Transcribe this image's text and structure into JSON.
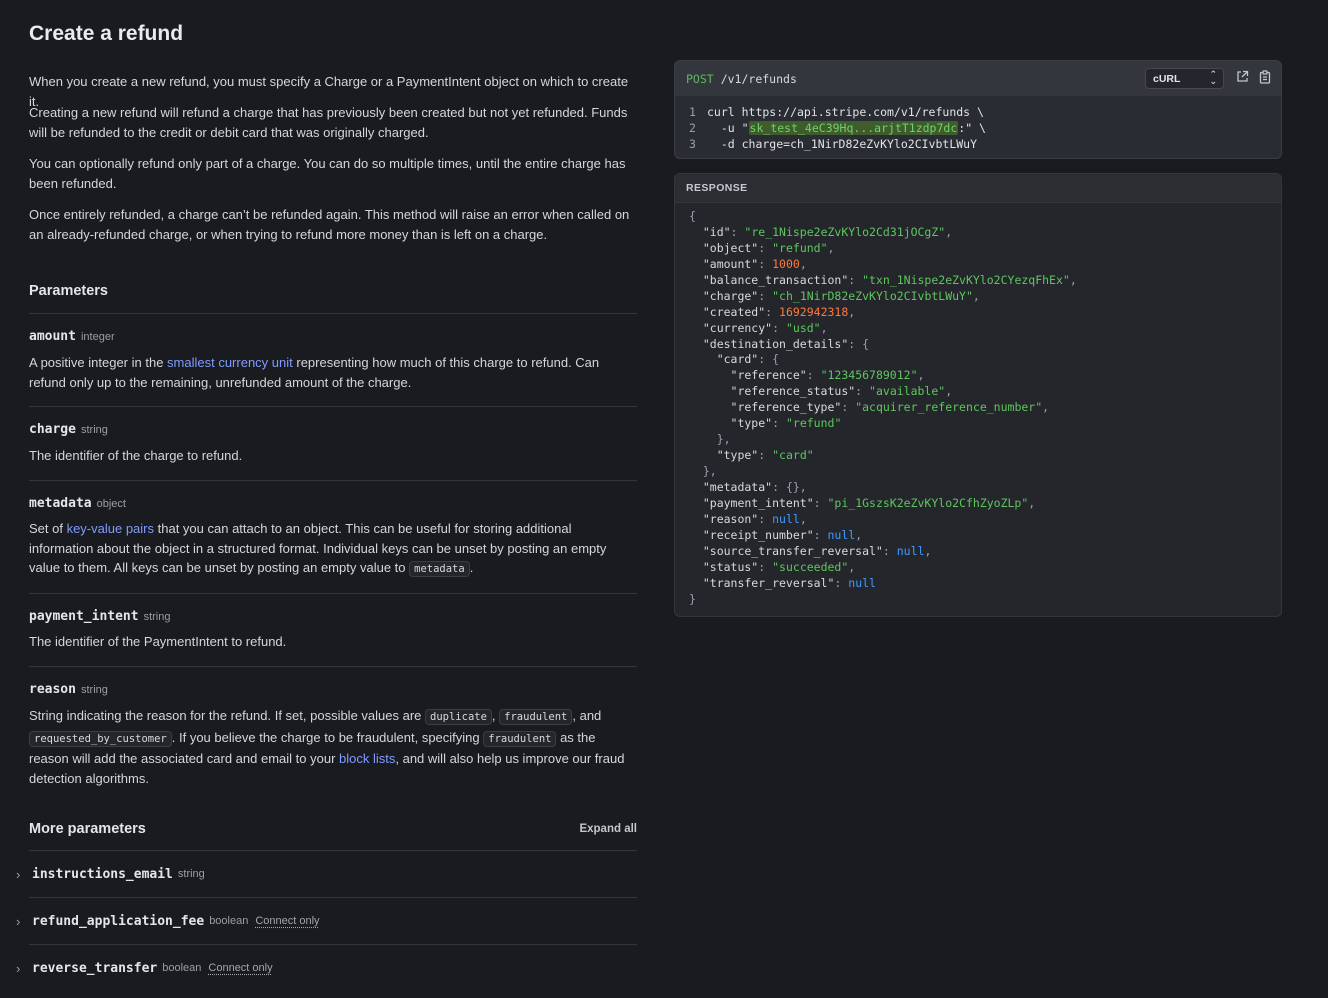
{
  "page": {
    "title": "Create a refund",
    "intro": [
      "When you create a new refund, you must specify a Charge or a PaymentIntent object on which to create it.",
      "Creating a new refund will refund a charge that has previously been created but not yet refunded. Funds will be refunded to the credit or debit card that was originally charged.",
      "You can optionally refund only part of a charge. You can do so multiple times, until the entire charge has been refunded.",
      "Once entirely refunded, a charge can’t be refunded again. This method will raise an error when called on an already-refunded charge, or when trying to refund more money than is left on a charge."
    ]
  },
  "parameters": {
    "heading": "Parameters",
    "amount": {
      "name": "amount",
      "type": "integer",
      "desc_before": "A positive integer in the ",
      "link": "smallest currency unit",
      "desc_after": " representing how much of this charge to refund. Can refund only up to the remaining, unrefunded amount of the charge."
    },
    "charge": {
      "name": "charge",
      "type": "string",
      "desc": "The identifier of the charge to refund."
    },
    "metadata": {
      "name": "metadata",
      "type": "object",
      "desc_before": "Set of ",
      "link": "key-value pairs",
      "desc_middle": " that you can attach to an object. This can be useful for storing additional information about the object in a structured format. Individual keys can be unset by posting an empty value to them. All keys can be unset by posting an empty value to ",
      "code": "metadata",
      "desc_after": "."
    },
    "payment_intent": {
      "name": "payment_intent",
      "type": "string",
      "desc": "The identifier of the PaymentIntent to refund."
    },
    "reason": {
      "name": "reason",
      "type": "string",
      "t1": "String indicating the reason for the refund. If set, possible values are ",
      "c1": "duplicate",
      "t2": ", ",
      "c2": "fraudulent",
      "t3": ", and ",
      "c3": "requested_by_customer",
      "t4": ". If you believe the charge to be fraudulent, specifying ",
      "c4": "fraudulent",
      "t5": " as the reason will add the associated card and email to your ",
      "link": "block lists",
      "t6": ", and will also help us improve our fraud detection algorithms."
    }
  },
  "more_parameters": {
    "heading": "More parameters",
    "expand_all": "Expand all",
    "items": [
      {
        "name": "instructions_email",
        "type": "string",
        "badge": ""
      },
      {
        "name": "refund_application_fee",
        "type": "boolean",
        "badge": "Connect only"
      },
      {
        "name": "reverse_transfer",
        "type": "boolean",
        "badge": "Connect only"
      }
    ]
  },
  "request": {
    "method": "POST",
    "path": "/v1/refunds",
    "language": "cURL",
    "lines": {
      "l1": {
        "num": "1",
        "text": "curl https://api.stripe.com/v1/refunds \\"
      },
      "l2": {
        "num": "2",
        "pre": "  -u \"",
        "key": "sk_test_4eC39Hq...arjtT1zdp7dc",
        "post": ":\" \\"
      },
      "l3": {
        "num": "3",
        "text": "  -d charge=ch_1NirD82eZvKYlo2CIvbtLWuY"
      }
    }
  },
  "response": {
    "label": "RESPONSE",
    "id": "re_1Nispe2eZvKYlo2Cd31jOCgZ",
    "object": "refund",
    "amount": "1000",
    "balance_transaction": "txn_1Nispe2eZvKYlo2CYezqFhEx",
    "charge": "ch_1NirD82eZvKYlo2CIvbtLWuY",
    "created": "1692942318",
    "currency": "usd",
    "reference": "123456789012",
    "reference_status": "available",
    "reference_type": "acquirer_reference_number",
    "card_type": "refund",
    "dest_type": "card",
    "payment_intent": "pi_1GszsK2eZvKYlo2CfhZyoZLp",
    "reason": "null",
    "receipt_number": "null",
    "source_transfer_reversal": "null",
    "status": "succeeded",
    "transfer_reversal": "null"
  }
}
